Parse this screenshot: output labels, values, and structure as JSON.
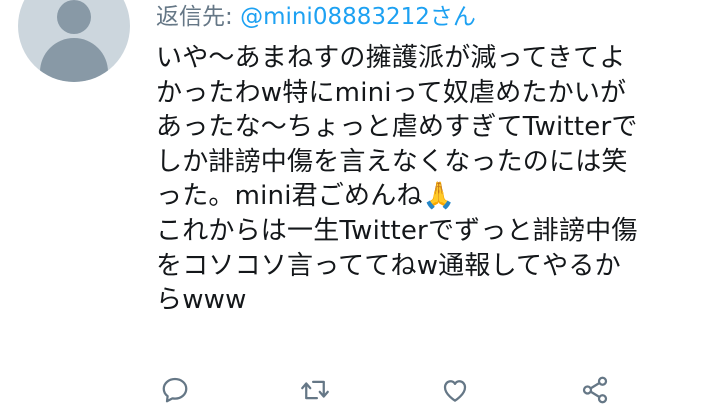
{
  "reply": {
    "prefix": "返信先: ",
    "handle": "@mini08883212さん"
  },
  "tweet": {
    "lines": [
      "いや〜あまねすの擁護派が減ってきてよ",
      "かったわw特にminiって奴虐めたかいが",
      "あったな〜ちょっと虐めすぎてTwitterで",
      "しか誹謗中傷を言えなくなったのには笑",
      "った。mini君ごめんね🙏",
      "これからは一生Twitterでずっと誹謗中傷",
      "をコソコソ言っててねw通報してやるか",
      "らwww"
    ]
  },
  "actions": {
    "reply_icon": "reply-icon",
    "retweet_icon": "retweet-icon",
    "like_icon": "like-icon",
    "share_icon": "share-icon"
  },
  "colors": {
    "icon": "#657786",
    "text": "#14171a",
    "link": "#1da1f2",
    "avatar_bg": "#ccd6dd",
    "avatar_fg": "#8899a6"
  }
}
